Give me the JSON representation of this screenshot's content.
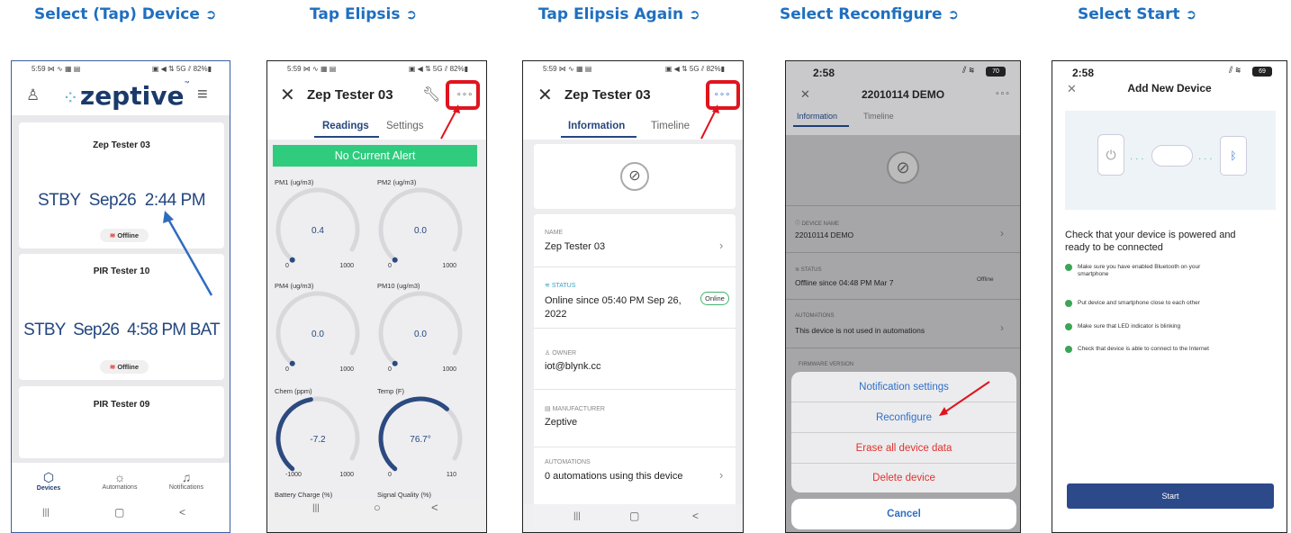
{
  "steps": [
    {
      "title": "Select (Tap) Device"
    },
    {
      "title": "Tap Elipsis"
    },
    {
      "title": "Tap Elipsis Again"
    },
    {
      "title": "Select Reconfigure"
    },
    {
      "title": "Select Start"
    }
  ],
  "phone1": {
    "status_left": "5:59 ⋈ ∿ ▦ ▤",
    "status_right": "▣ ◀ ⇅ 5G ⫽ 82%▮",
    "brand": "zeptive",
    "brand_mark": "™",
    "devices": [
      {
        "name": "Zep Tester 03",
        "reading": "STBY  Sep26  2:44 PM",
        "status": "Offline"
      },
      {
        "name": "PIR Tester 10",
        "reading": "STBY  Sep26  4:58 PM BAT",
        "status": "Offline"
      },
      {
        "name": "PIR Tester 09",
        "reading": "",
        "status": ""
      }
    ],
    "nav": [
      {
        "label": "Devices"
      },
      {
        "label": "Automations"
      },
      {
        "label": "Notifications"
      }
    ],
    "sys_nav": [
      "|||",
      "▢",
      "<"
    ]
  },
  "phone2": {
    "status_left": "5:59 ⋈ ∿ ▦ ▤",
    "status_right": "▣ ◀ ⇅ 5G ⫽ 82%▮",
    "title": "Zep Tester 03",
    "tabs": [
      "Readings",
      "Settings"
    ],
    "alert": "No Current Alert",
    "gauges": [
      {
        "label": "PM1 (ug/m3)",
        "value": "0.4",
        "min": "0",
        "max": "1000",
        "fill": 0.0
      },
      {
        "label": "PM2 (ug/m3)",
        "value": "0.0",
        "min": "0",
        "max": "1000",
        "fill": 0.0
      },
      {
        "label": "PM4 (ug/m3)",
        "value": "0.0",
        "min": "0",
        "max": "1000",
        "fill": 0.0
      },
      {
        "label": "PM10 (ug/m3)",
        "value": "0.0",
        "min": "0",
        "max": "1000",
        "fill": 0.0
      },
      {
        "label": "Chem (ppm)",
        "value": "-7.2",
        "min": "-1000",
        "max": "1000",
        "fill": 0.5
      },
      {
        "label": "Temp (F)",
        "value": "76.7°",
        "min": "0",
        "max": "110",
        "fill": 0.7
      }
    ],
    "bottom_labels": [
      "Battery Charge (%)",
      "Signal Quality (%)"
    ],
    "sys_nav": [
      "|||",
      "○",
      "<"
    ]
  },
  "phone3": {
    "status_left": "5:59 ⋈ ∿ ▦ ▤",
    "status_right": "▣ ◀ ⇅ 5G ⫽ 82%▮",
    "title": "Zep Tester 03",
    "tabs": [
      "Information",
      "Timeline"
    ],
    "name_label": "NAME",
    "name_value": "Zep Tester 03",
    "status_label": "STATUS",
    "status_value": "Online since 05:40 PM Sep 26, 2022",
    "status_badge": "Online",
    "owner_label": "OWNER",
    "owner_value": "iot@blynk.cc",
    "manufacturer_label": "MANUFACTURER",
    "manufacturer_value": "Zeptive",
    "automations_label": "AUTOMATIONS",
    "automations_value": "0 automations using this device",
    "sys_nav": [
      "|||",
      "▢",
      "<"
    ]
  },
  "phone4": {
    "time": "2:58",
    "signal": "⫽ ≋",
    "battery": "70",
    "title": "22010114 DEMO",
    "tabs": [
      "Information",
      "Timeline"
    ],
    "device_name_label": "DEVICE NAME",
    "device_name_value": "22010114 DEMO",
    "status_label": "STATUS",
    "status_value": "Offline since 04:48 PM Mar 7",
    "status_badge": "Offline",
    "automations_label": "AUTOMATIONS",
    "automations_value": "This device is not used in automations",
    "firmware_label": "FIRMWARE VERSION",
    "sheet_items": [
      "Notification settings",
      "Reconfigure",
      "Erase all device data",
      "Delete device"
    ],
    "cancel": "Cancel",
    "colors": {
      "blue": "#2f6fc8",
      "red": "#e0332e"
    }
  },
  "phone5": {
    "time": "2:58",
    "signal": "⫽ ≋",
    "battery": "69",
    "title": "Add New Device",
    "heading": "Check that your device is powered and ready to be connected",
    "checks": [
      "Make sure you have enabled Bluetooth on your smartphone",
      "Put device and smartphone close to each other",
      "Make sure that LED indicator is blinking",
      "Check that device is able to connect to the Internet"
    ],
    "start": "Start",
    "colors": {
      "check": "#3aa656",
      "button": "#2c4a8a"
    }
  }
}
